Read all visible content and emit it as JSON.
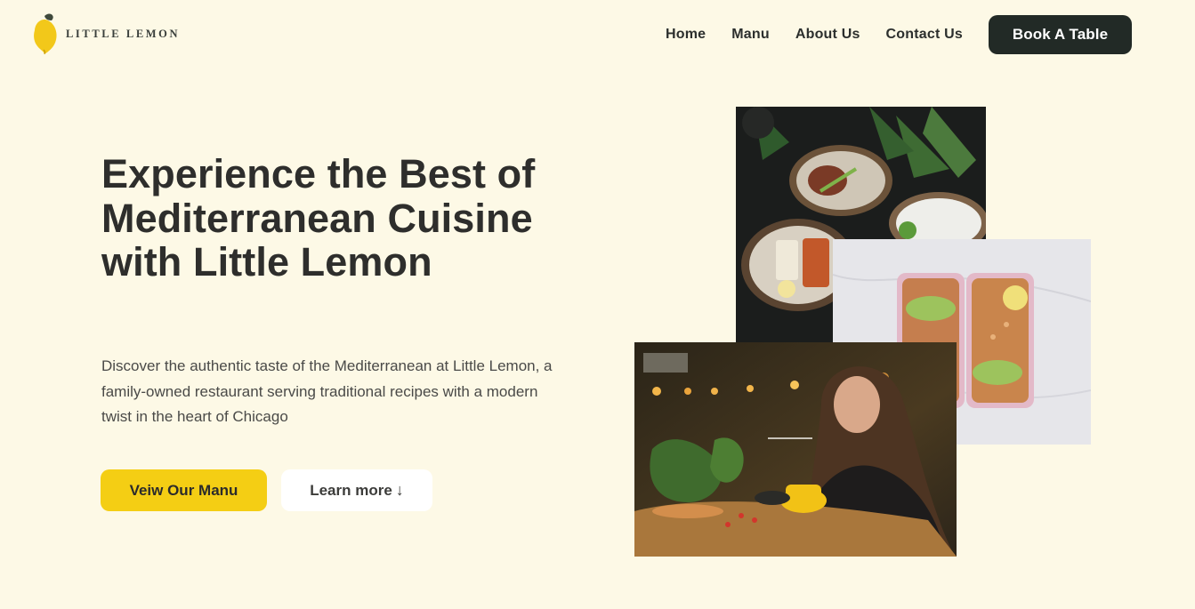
{
  "header": {
    "logo_text": "LITTLE LEMON",
    "nav": [
      {
        "label": "Home"
      },
      {
        "label": "Manu"
      },
      {
        "label": "About Us"
      },
      {
        "label": "Contact Us"
      }
    ],
    "cta_label": "Book A Table"
  },
  "hero": {
    "title": "Experience the Best of Mediterranean Cuisine with Little Lemon",
    "description": "Discover the authentic taste of the Mediterranean at Little Lemon, a family-owned restaurant serving traditional recipes with a modern twist in the heart of Chicago",
    "primary_button": "Veiw Our Manu",
    "secondary_button": "Learn more",
    "secondary_button_icon": "↓"
  },
  "icons": {
    "logo": "lemon-icon",
    "learn_more": "arrow-down-icon"
  },
  "colors": {
    "background": "#fdf9e6",
    "primary_yellow": "#f4ce14",
    "dark": "#222a26"
  }
}
